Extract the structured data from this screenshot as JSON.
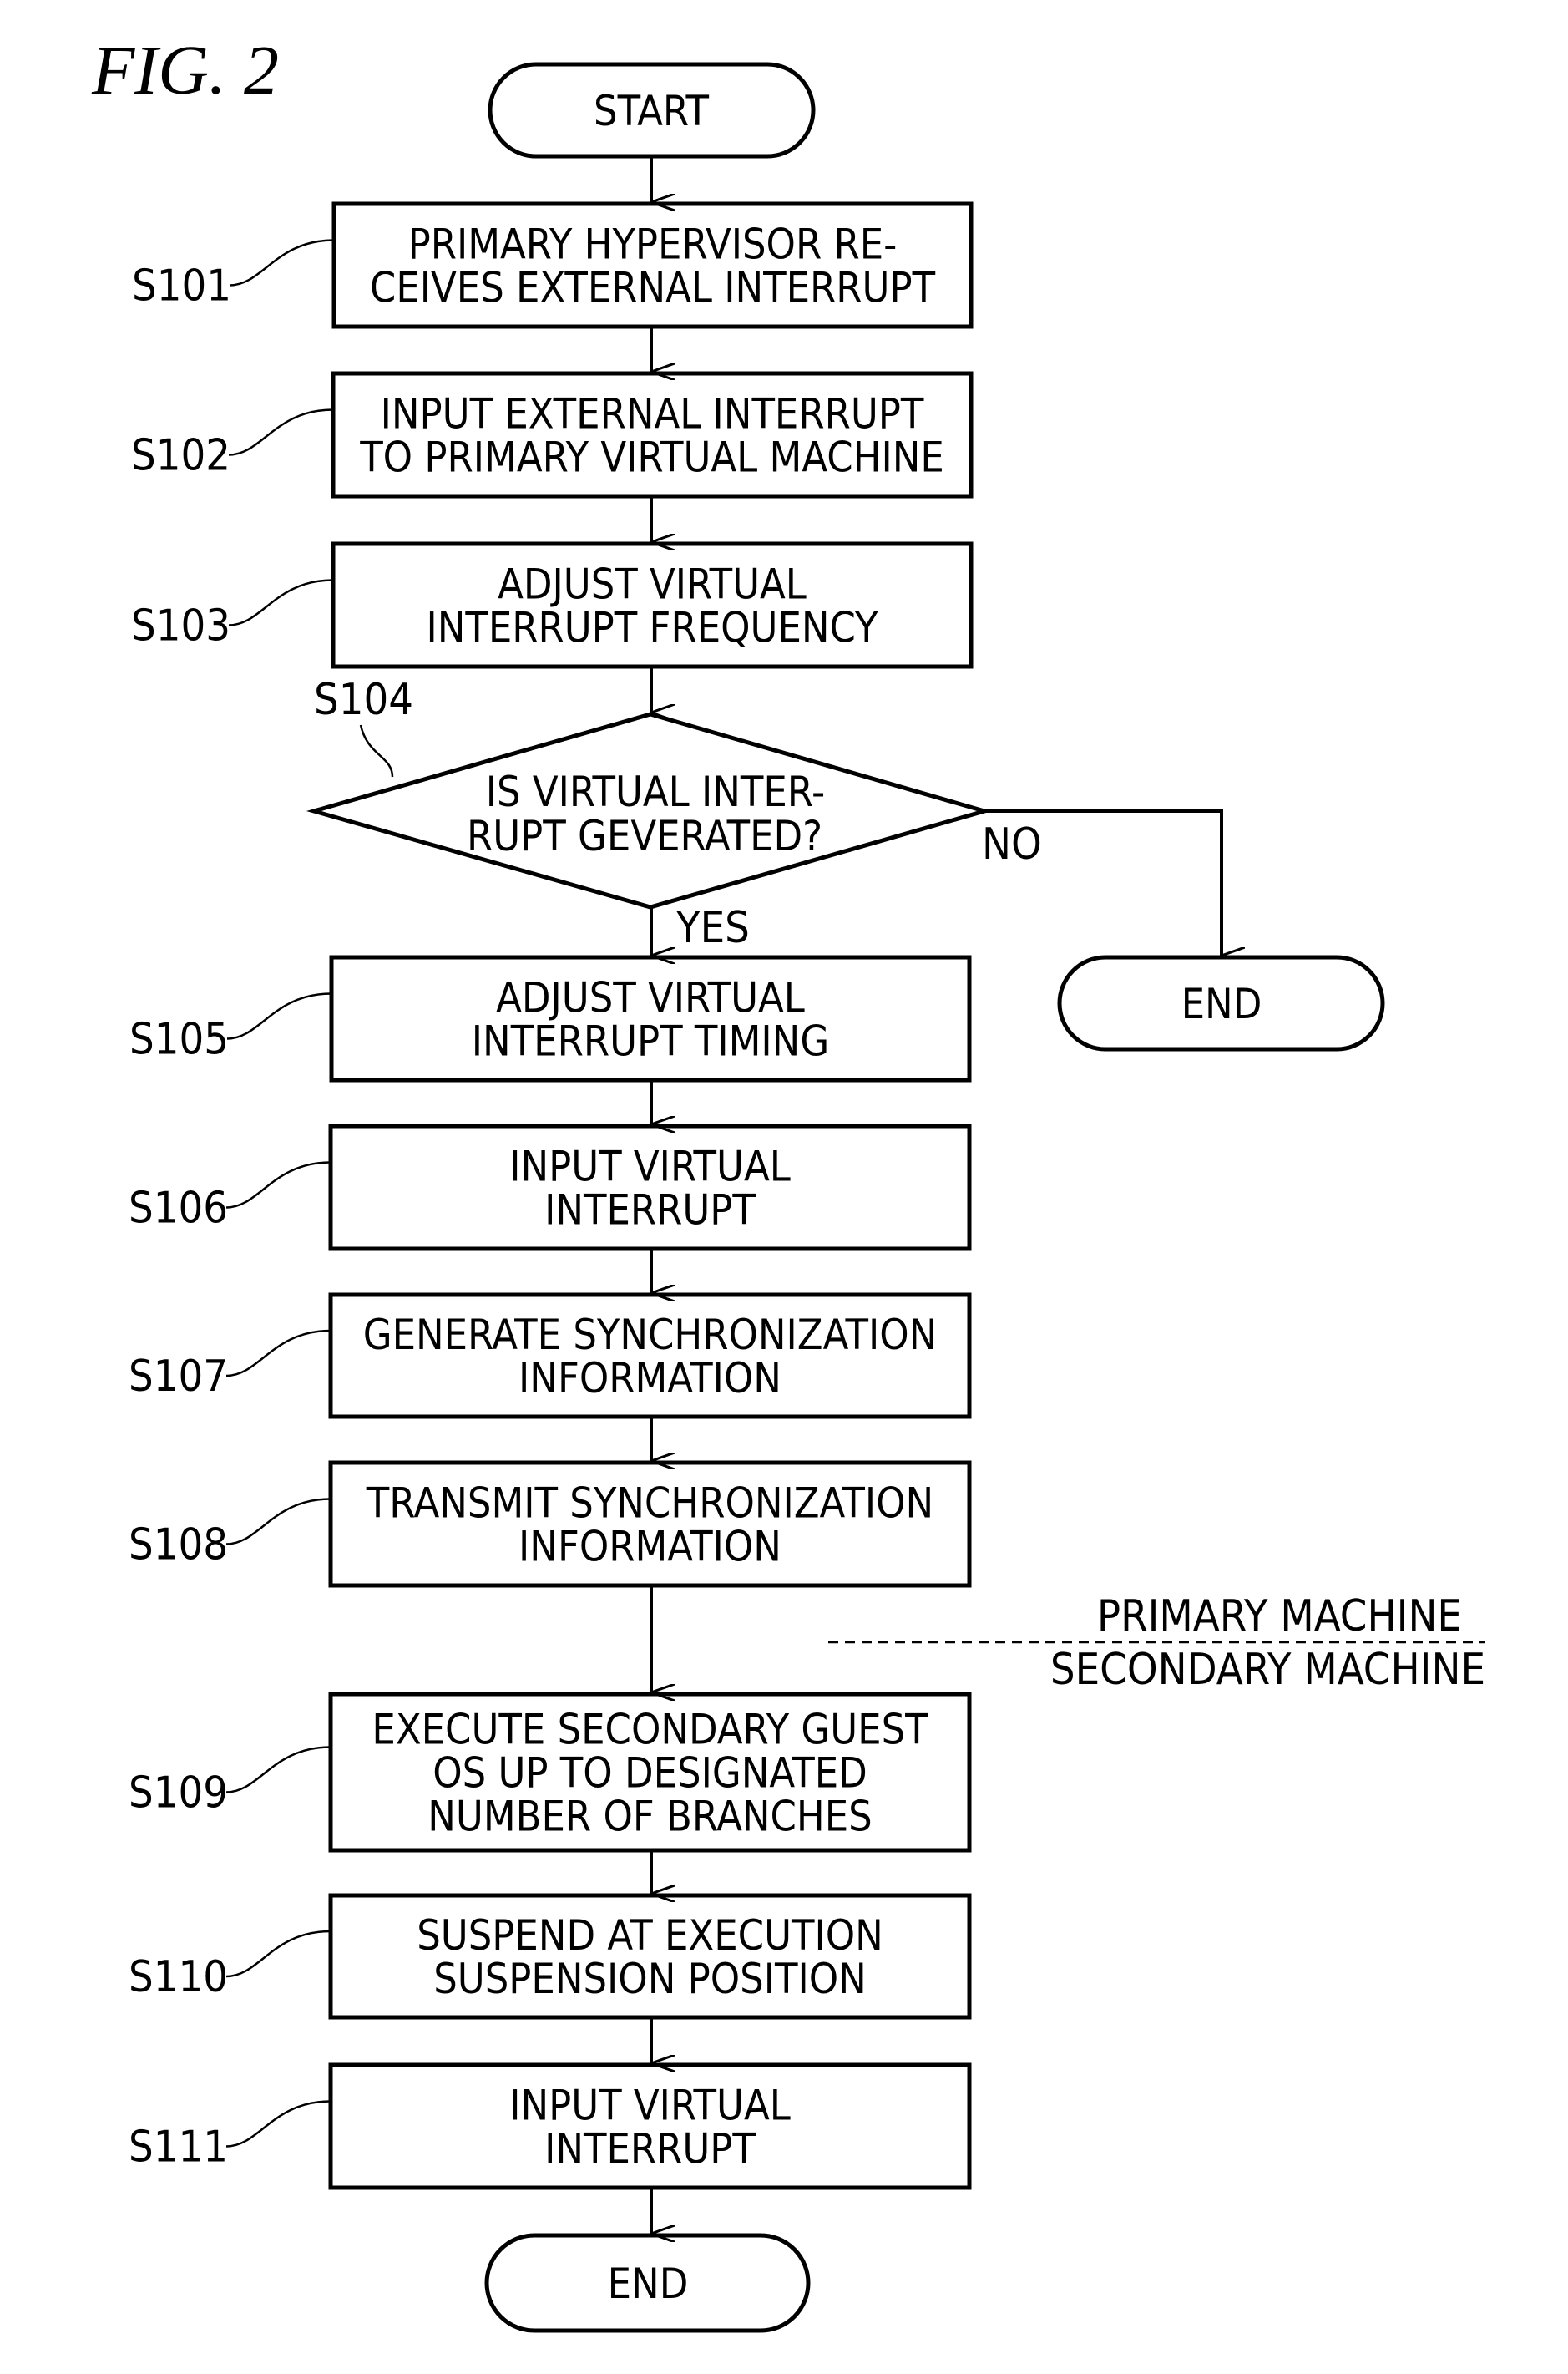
{
  "figure": {
    "title": "FIG. 2"
  },
  "terminals": {
    "start": "START",
    "end_no": "END",
    "end_final": "END"
  },
  "steps": [
    {
      "id": "S101",
      "lines": [
        "PRIMARY HYPERVISOR RE-",
        "CEIVES EXTERNAL INTERRUPT"
      ]
    },
    {
      "id": "S102",
      "lines": [
        "INPUT EXTERNAL INTERRUPT",
        "TO PRIMARY VIRTUAL MACHINE"
      ]
    },
    {
      "id": "S103",
      "lines": [
        "ADJUST VIRTUAL",
        "INTERRUPT FREQUENCY"
      ]
    },
    {
      "id": "S105",
      "lines": [
        "ADJUST VIRTUAL",
        "INTERRUPT TIMING"
      ]
    },
    {
      "id": "S106",
      "lines": [
        "INPUT VIRTUAL",
        "INTERRUPT"
      ]
    },
    {
      "id": "S107",
      "lines": [
        "GENERATE SYNCHRONIZATION",
        "INFORMATION"
      ]
    },
    {
      "id": "S108",
      "lines": [
        "TRANSMIT SYNCHRONIZATION",
        "INFORMATION"
      ]
    },
    {
      "id": "S109",
      "lines": [
        "EXECUTE SECONDARY GUEST",
        "OS UP TO DESIGNATED",
        "NUMBER OF BRANCHES"
      ]
    },
    {
      "id": "S110",
      "lines": [
        "SUSPEND AT EXECUTION",
        "SUSPENSION POSITION"
      ]
    },
    {
      "id": "S111",
      "lines": [
        "INPUT VIRTUAL",
        "INTERRUPT"
      ]
    }
  ],
  "decision": {
    "id": "S104",
    "lines": [
      "IS VIRTUAL INTER-",
      "RUPT GEVERATED?"
    ],
    "yes_label": "YES",
    "no_label": "NO"
  },
  "divider": {
    "upper_label": "PRIMARY MACHINE",
    "lower_label": "SECONDARY MACHINE"
  }
}
